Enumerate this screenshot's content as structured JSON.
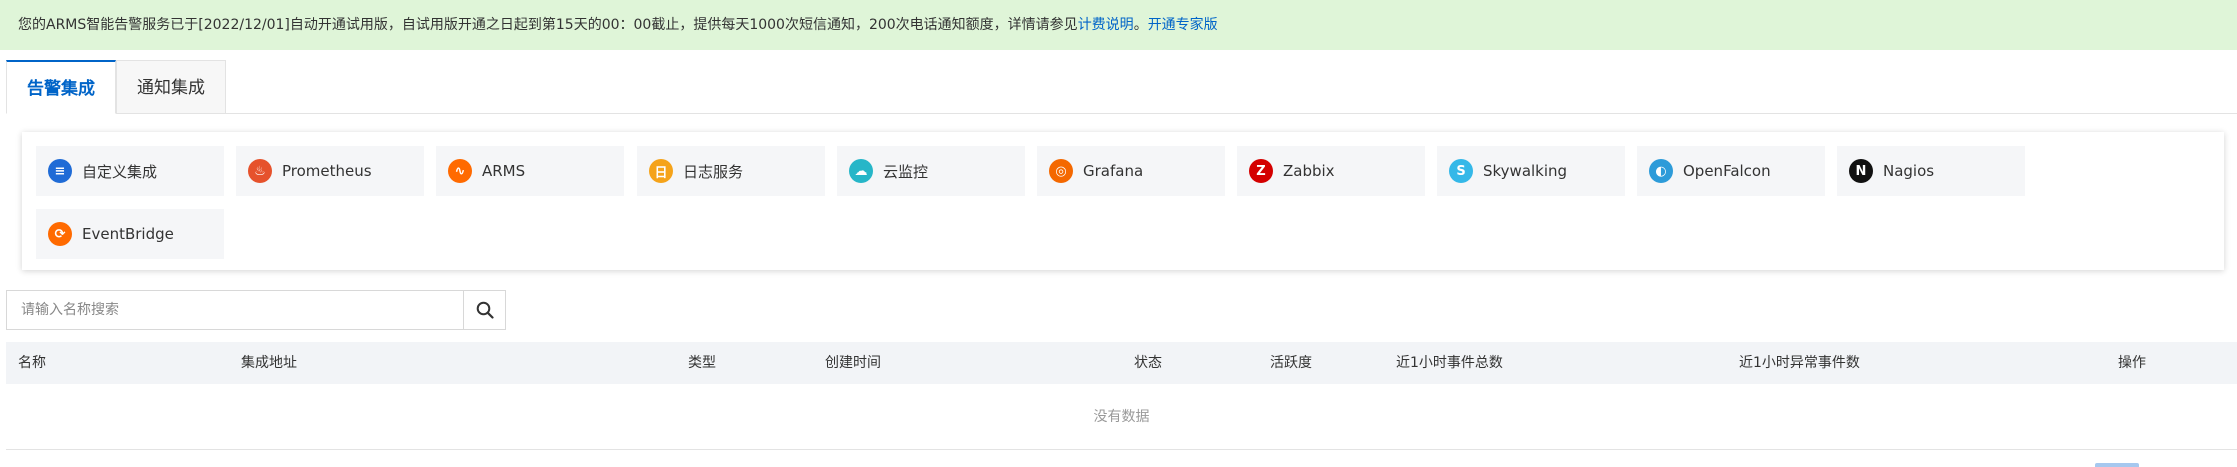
{
  "banner": {
    "text": "您的ARMS智能告警服务已于[2022/12/01]自动开通试用版，自试用版开通之日起到第15天的00：00截止，提供每天1000次短信通知，200次电话通知额度，详情请参见",
    "link_pricing": "计费说明",
    "separator": "。",
    "link_upgrade": "开通专家版"
  },
  "tabs": [
    {
      "label": "告警集成",
      "active": true
    },
    {
      "label": "通知集成",
      "active": false
    }
  ],
  "integrations": [
    {
      "label": "自定义集成",
      "icon": "custom-integration-icon",
      "color": "#1f6bd6",
      "glyph": "≡"
    },
    {
      "label": "Prometheus",
      "icon": "prometheus-icon",
      "color": "#e6522c",
      "glyph": "♨"
    },
    {
      "label": "ARMS",
      "icon": "arms-icon",
      "color": "#ff6a00",
      "glyph": "∿"
    },
    {
      "label": "日志服务",
      "icon": "log-service-icon",
      "color": "#f5a31a",
      "glyph": "日"
    },
    {
      "label": "云监控",
      "icon": "cloud-monitor-icon",
      "color": "#26b6c8",
      "glyph": "☁"
    },
    {
      "label": "Grafana",
      "icon": "grafana-icon",
      "color": "#f46800",
      "glyph": "◎"
    },
    {
      "label": "Zabbix",
      "icon": "zabbix-icon",
      "color": "#d40000",
      "glyph": "Z"
    },
    {
      "label": "Skywalking",
      "icon": "skywalking-icon",
      "color": "#34b8e8",
      "glyph": "S"
    },
    {
      "label": "OpenFalcon",
      "icon": "openfalcon-icon",
      "color": "#2d9bd9",
      "glyph": "◐"
    },
    {
      "label": "Nagios",
      "icon": "nagios-icon",
      "color": "#111111",
      "glyph": "N"
    },
    {
      "label": "EventBridge",
      "icon": "eventbridge-icon",
      "color": "#ff6a00",
      "glyph": "⟳"
    }
  ],
  "search": {
    "placeholder": "请输入名称搜索",
    "value": ""
  },
  "table": {
    "columns": [
      "名称",
      "集成地址",
      "类型",
      "创建时间",
      "状态",
      "活跃度",
      "近1小时事件总数",
      "近1小时异常事件数",
      "操作"
    ],
    "empty_text": "没有数据"
  }
}
